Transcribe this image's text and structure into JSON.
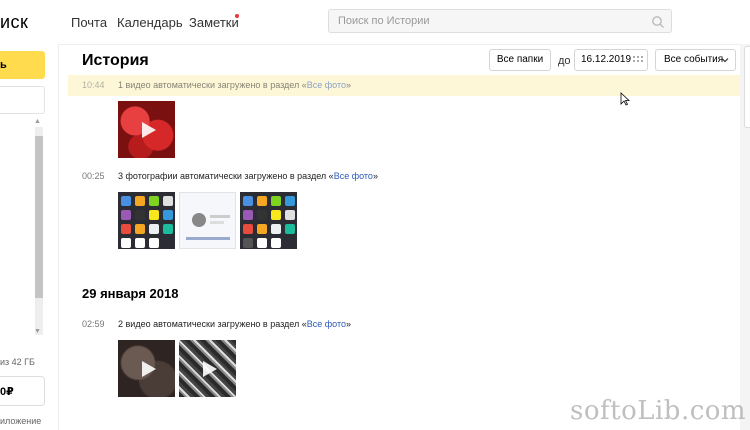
{
  "header": {
    "logo": "иск",
    "nav": [
      "Почта",
      "Календарь",
      "Заметки"
    ],
    "search_placeholder": "Поиск по Истории"
  },
  "sidebar": {
    "primary_button": "ь",
    "quota": "из 42 ГБ",
    "buy_button": "0₽",
    "app_label": "иложение"
  },
  "page": {
    "title": "История",
    "folders_button": "Все папки",
    "date_prefix": "до",
    "date_value": "16.12.2019",
    "events_button": "Все события"
  },
  "events": [
    {
      "time": "10:44",
      "text": "1 видео автоматически загружено в раздел «",
      "link": "Все фото",
      "suffix": "»"
    },
    {
      "time": "00:25",
      "text": "3 фотографии автоматически загружено в раздел «",
      "link": "Все фото",
      "suffix": "»"
    },
    {
      "time": "02:59",
      "text": "2 видео автоматически загружено в раздел «",
      "link": "Все фото",
      "suffix": "»"
    }
  ],
  "date_heading": "29 января 2018",
  "watermark": "softoLib.com",
  "colors": {
    "accent": "#ffdb4d",
    "link": "#2b5bb8",
    "highlight": "#fdf7d8"
  }
}
